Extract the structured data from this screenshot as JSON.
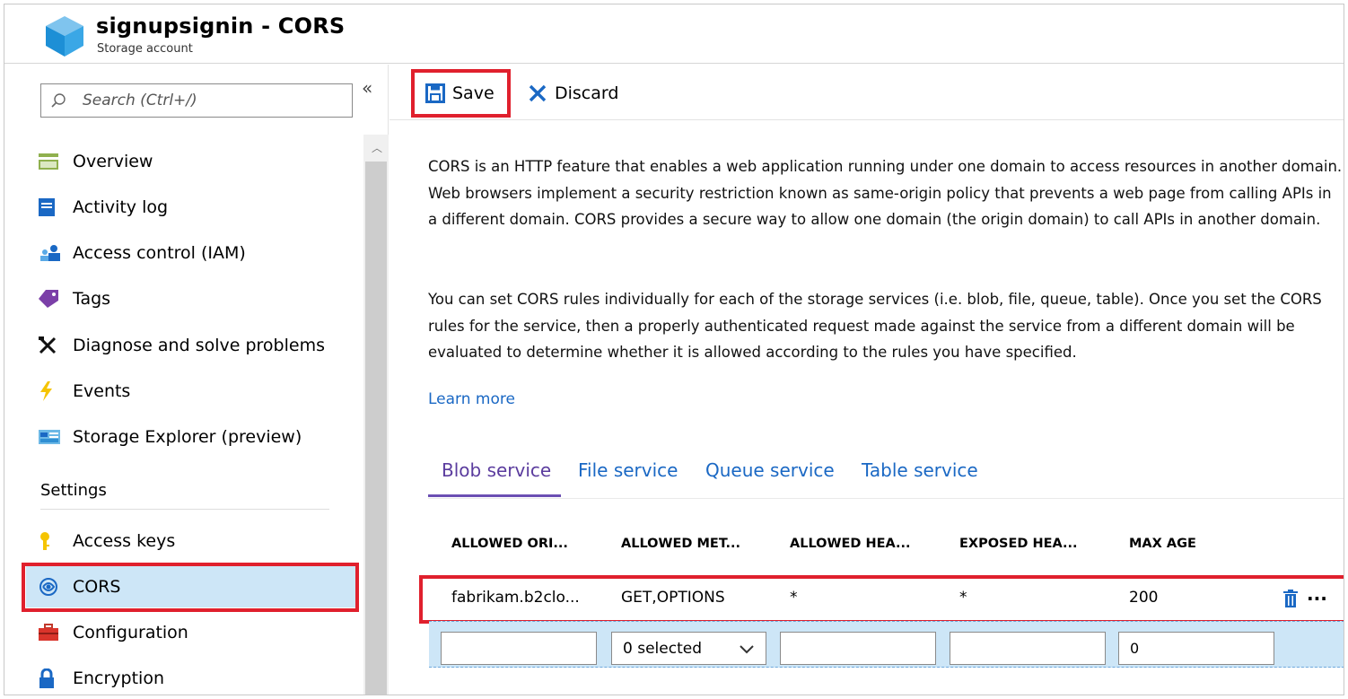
{
  "header": {
    "title": "signupsignin - CORS",
    "subtitle": "Storage account"
  },
  "sidebar": {
    "search_placeholder": "Search (Ctrl+/)",
    "collapse_label": "«",
    "items": [
      {
        "label": "Overview",
        "icon": "overview-icon"
      },
      {
        "label": "Activity log",
        "icon": "activity-log-icon"
      },
      {
        "label": "Access control (IAM)",
        "icon": "access-control-icon"
      },
      {
        "label": "Tags",
        "icon": "tag-icon"
      },
      {
        "label": "Diagnose and solve problems",
        "icon": "wrench-icon"
      },
      {
        "label": "Events",
        "icon": "lightning-icon"
      },
      {
        "label": "Storage Explorer (preview)",
        "icon": "storage-explorer-icon"
      }
    ],
    "settings_title": "Settings",
    "settings_items": [
      {
        "label": "Access keys",
        "icon": "key-icon"
      },
      {
        "label": "CORS",
        "icon": "cors-icon",
        "active": true
      },
      {
        "label": "Configuration",
        "icon": "toolbox-icon"
      },
      {
        "label": "Encryption",
        "icon": "lock-icon"
      }
    ]
  },
  "toolbar": {
    "save_label": "Save",
    "discard_label": "Discard"
  },
  "main": {
    "paragraph1": "CORS is an HTTP feature that enables a web application running under one domain to access resources in another domain. Web browsers implement a security restriction known as same-origin policy that prevents a web page from calling APIs in a different domain. CORS provides a secure way to allow one domain (the origin domain) to call APIs in another domain.",
    "paragraph2": "You can set CORS rules individually for each of the storage services (i.e. blob, file, queue, table). Once you set the CORS rules for the service, then a properly authenticated request made against the service from a different domain will be evaluated to determine whether it is allowed according to the rules you have specified.",
    "learn_more": "Learn more",
    "tabs": [
      {
        "label": "Blob service",
        "active": true
      },
      {
        "label": "File service"
      },
      {
        "label": "Queue service"
      },
      {
        "label": "Table service"
      }
    ]
  },
  "table": {
    "headers": [
      "ALLOWED ORI...",
      "ALLOWED MET...",
      "ALLOWED HEA...",
      "EXPOSED HEA...",
      "MAX AGE"
    ],
    "rows": [
      [
        "fabrikam.b2clo...",
        "GET,OPTIONS",
        "*",
        "*",
        "200"
      ]
    ],
    "new_row": {
      "allowed_origins": "",
      "allowed_methods": "0 selected",
      "allowed_headers": "",
      "exposed_headers": "",
      "max_age": "0"
    },
    "more_label": "···"
  },
  "colors": {
    "accent": "#1a68c4",
    "highlight_box": "#e0202d",
    "active_bg": "#cde6f7",
    "active_tab": "#6b4fb3"
  }
}
